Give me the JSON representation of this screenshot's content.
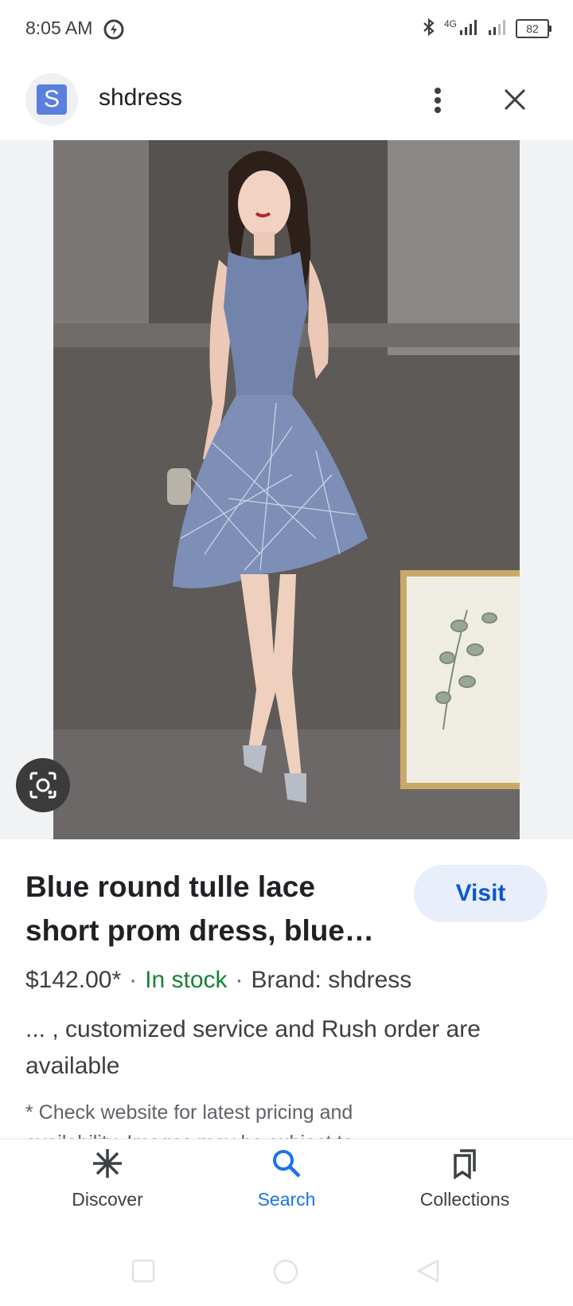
{
  "status_bar": {
    "time": "8:05 AM",
    "network": "4G",
    "battery": "82",
    "icons": [
      "data-saver-icon",
      "bluetooth-icon",
      "signal-icon",
      "signal-icon",
      "battery-icon"
    ]
  },
  "header": {
    "avatar_letter": "S",
    "site_name": "shdress",
    "icons": [
      "more-vert-icon",
      "close-icon"
    ]
  },
  "image": {
    "description_icon": "google-lens-icon"
  },
  "result": {
    "title": "Blue round tulle lace short prom dress, blue…",
    "visit_label": "Visit",
    "price": "$142.00*",
    "stock": "In stock",
    "brand": "Brand: shdress",
    "separator": "·",
    "description": "... , customized service and Rush order are available",
    "note": "* Check website for latest pricing and availability. Images may be subject to"
  },
  "bottom_nav": {
    "items": [
      {
        "label": "Discover",
        "icon": "asterisk-icon"
      },
      {
        "label": "Search",
        "icon": "search-icon",
        "active": true
      },
      {
        "label": "Collections",
        "icon": "bookmarks-icon"
      }
    ]
  },
  "colors": {
    "accent": "#1a73e8",
    "visit_bg": "#e8eefa",
    "stock_green": "#188038"
  }
}
